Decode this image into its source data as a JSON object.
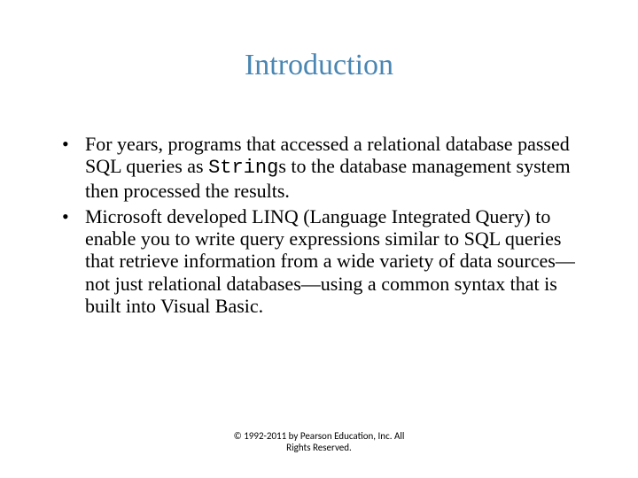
{
  "title": "Introduction",
  "bullets": [
    {
      "pre": "For years, programs that accessed a relational database passed SQL queries as ",
      "code": "String",
      "post": "s to the database management system then processed the results."
    },
    {
      "pre": "Microsoft developed LINQ (Language Integrated Query) to enable you to write query expressions similar to SQL queries that retrieve information from a wide variety of data sources—not just relational databases—using a common syntax that is built into Visual Basic.",
      "code": "",
      "post": ""
    }
  ],
  "footer_line1": "© 1992-2011 by Pearson Education, Inc. All",
  "footer_line2": "Rights Reserved."
}
